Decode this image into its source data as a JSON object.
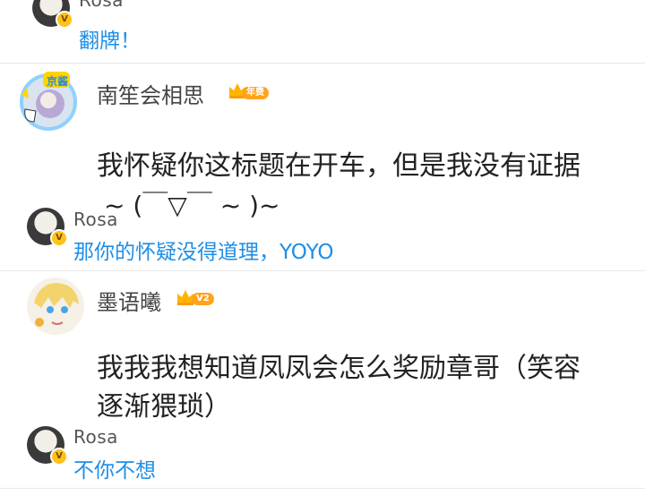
{
  "threads": [
    {
      "reply_name": "Rosa",
      "reply_text": "翻牌！"
    },
    {
      "author": "南笙会相思",
      "author_badge": "年费",
      "avatar_badge_text": "京酱",
      "comment_line1": "我怀疑你这标题在开车，但是我没有证据",
      "comment_line2": "~ (￣▽￣ ~ )~",
      "reply_name": "Rosa",
      "reply_text": "那你的怀疑没得道理，YOYO"
    },
    {
      "author": "墨语曦",
      "author_badge": "V2",
      "comment_line1": "我我我想知道凤凤会怎么奖励章哥（笑容",
      "comment_line2": "逐渐猥琐）",
      "reply_name": "Rosa",
      "reply_text": "不你不想"
    }
  ],
  "colors": {
    "reply_text": "#1f8ee6",
    "crown_gold": "#ffb300",
    "vip_badge": "#ffc21a"
  },
  "icons": {
    "crown": "crown-icon",
    "verified": "v-badge-icon"
  }
}
